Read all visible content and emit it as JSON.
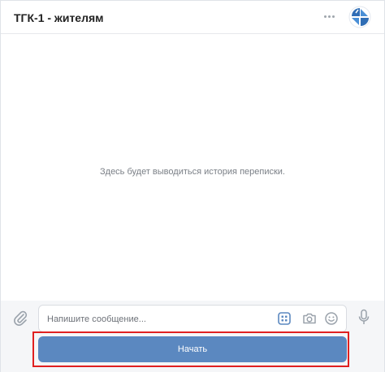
{
  "header": {
    "title": "ТГК-1 - жителям",
    "more_icon": "more-horizontal-icon",
    "avatar_icon": "community-logo"
  },
  "history": {
    "empty_text": "Здесь будет выводиться история переписки."
  },
  "composer": {
    "attach_icon": "paperclip-icon",
    "placeholder": "Напишите сообщение...",
    "value": "",
    "keyboard_icon": "bot-keyboard-icon",
    "camera_icon": "camera-icon",
    "emoji_icon": "emoji-icon",
    "mic_icon": "microphone-icon"
  },
  "start_button": {
    "label": "Начать"
  },
  "colors": {
    "accent": "#5b88c0",
    "highlight": "#e02020",
    "logo": "#2f6db5"
  }
}
